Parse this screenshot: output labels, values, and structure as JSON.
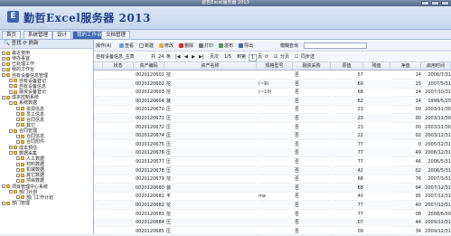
{
  "window": {
    "title": "勤哲Excel服务器 2013"
  },
  "header": {
    "app_title": "勤哲Excel服务器 2013",
    "logo": "E"
  },
  "menu": {
    "tabs": [
      "首页",
      "系统管理",
      "设计",
      "我的工作台",
      "文档管理"
    ],
    "active_index": 3
  },
  "left": {
    "tools": {
      "search": "查找",
      "refresh": "刷新"
    },
    "tree": [
      {
        "label": "最近使用",
        "indent": 1
      },
      {
        "label": "待办事宜",
        "indent": 1
      },
      {
        "label": "已处理工作",
        "indent": 1
      },
      {
        "label": "我的工作台",
        "indent": 1
      },
      {
        "label": "自有设备信息管理",
        "indent": 1
      },
      {
        "label": "自有设备登记",
        "indent": 2
      },
      {
        "label": "自有设备信息",
        "indent": 2
      },
      {
        "label": "融资设备登记",
        "indent": 2
      },
      {
        "label": "成本控制系统",
        "indent": 1
      },
      {
        "label": "系统数据",
        "indent": 2
      },
      {
        "label": "资源信息",
        "indent": 3
      },
      {
        "label": "员工信息",
        "indent": 3
      },
      {
        "label": "合同信息",
        "indent": 3
      },
      {
        "label": "其它",
        "indent": 3
      },
      {
        "label": "合同管理",
        "indent": 2
      },
      {
        "label": "合同信息",
        "indent": 3
      },
      {
        "label": "合同附件",
        "indent": 3
      },
      {
        "label": "成本预估",
        "indent": 2
      },
      {
        "label": "数据采集",
        "indent": 2
      },
      {
        "label": "人工数据",
        "indent": 3
      },
      {
        "label": "材料数据",
        "indent": 3
      },
      {
        "label": "机械数据",
        "indent": 3
      },
      {
        "label": "其它数据",
        "indent": 3
      },
      {
        "label": "项目数据",
        "indent": 3
      },
      {
        "label": "项目管理中心系统",
        "indent": 1
      },
      {
        "label": "部门计划",
        "indent": 2
      },
      {
        "label": "部门工作计划",
        "indent": 3
      },
      {
        "label": "部门管理",
        "indent": 1
      }
    ]
  },
  "toolbar": {
    "buttons": [
      "操作(A)",
      "查看",
      "新建",
      "修改",
      "删除",
      "打印",
      "发布",
      "导出",
      "模糊查询"
    ],
    "search_placeholder": ""
  },
  "pager": {
    "report_name": "自有设备信息_主表",
    "total_label": "共",
    "total": "24",
    "total_unit": "条",
    "page_label": "页次",
    "page": "1/5",
    "goto_label": "到第",
    "goto_value": "1",
    "page_unit": "页",
    "paging_label": "分页",
    "same_step_label": "同步选"
  },
  "grid": {
    "columns": [
      "状态",
      "资产编码",
      "资产名称",
      "规格型号",
      "融资采购",
      "原值",
      "残值",
      "净值",
      "启用时间"
    ],
    "rows": [
      [
        "",
        "0020120601",
        "挖",
        "",
        "否",
        "57",
        "14",
        "2006/7/31"
      ],
      [
        "",
        "0020120602",
        "挖",
        "(~9)",
        "否",
        "69",
        "15",
        "2007/5/31"
      ],
      [
        "",
        "0020120603",
        "挖",
        "(~10)",
        "否",
        "68",
        "14",
        "2007/10/31"
      ],
      [
        "",
        "0020120604",
        "装",
        "",
        "否",
        "62",
        "14",
        "1999/5/25"
      ],
      [
        "",
        "0020120670",
        "压",
        "",
        "否",
        "23",
        "00",
        "2003/11/30"
      ],
      [
        "",
        "0020120671",
        "压",
        "",
        "否",
        "23",
        "00",
        "2003/11/30"
      ],
      [
        "",
        "0020120672",
        "压",
        "",
        "否",
        "23",
        "00",
        "2003/11/30"
      ],
      [
        "",
        "0020120674",
        "压",
        "",
        "否",
        "22",
        "02",
        "2003/12/31"
      ],
      [
        "",
        "0020120675",
        "压",
        "",
        "否",
        "77",
        "0",
        "2005/12/31"
      ],
      [
        "",
        "0020120676",
        "压",
        "",
        "否",
        "77",
        "49",
        "2006/12/31"
      ],
      [
        "",
        "0020120677",
        "压",
        "",
        "否",
        "77",
        "46",
        "2006/5/31"
      ],
      [
        "",
        "0020120678",
        "压",
        "",
        "否",
        "42",
        "02",
        "2006/5/31"
      ],
      [
        "",
        "0020120679",
        "挖",
        "",
        "否",
        "68",
        "76",
        "2007/3/31"
      ],
      [
        "",
        "0020120680",
        "装",
        "",
        "否",
        "68",
        "94",
        "2007/12/31"
      ],
      [
        "",
        "0020120681",
        "平",
        "ma",
        "否",
        "40",
        "95",
        "2007/12/31"
      ],
      [
        "",
        "0020120682",
        "挖",
        "",
        "否",
        "77",
        "40",
        "2007/12/31"
      ],
      [
        "",
        "0020120683",
        "挖",
        "",
        "否",
        "77",
        "08",
        "2008/6/30"
      ],
      [
        "",
        "0020120684",
        "压",
        "",
        "否",
        "07",
        "44",
        "2009/12/31"
      ],
      [
        "",
        "0020120685",
        "压",
        "",
        "否",
        "09",
        "34",
        "2009/12/31"
      ]
    ]
  },
  "colors": {
    "accent": "#3b66b0",
    "title": "#1d3f86"
  }
}
